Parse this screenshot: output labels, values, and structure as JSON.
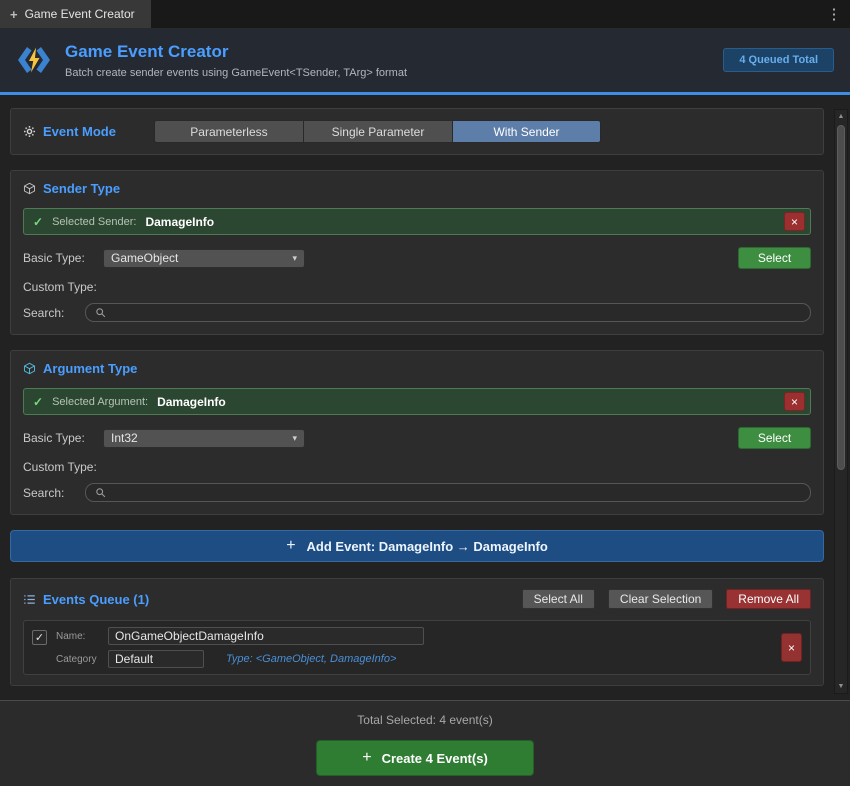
{
  "icons": {
    "plus": "+",
    "kebab": "⋮",
    "check": "✓",
    "close": "×",
    "chevron_down": "▾",
    "scroll_up": "▲",
    "scroll_down": "▼"
  },
  "tabbar": {
    "tab_title": "Game Event Creator"
  },
  "header": {
    "title": "Game Event Creator",
    "subtitle": "Batch create sender events using GameEvent<TSender, TArg> format",
    "badge": "4 Queued Total"
  },
  "event_mode": {
    "title": "Event Mode",
    "options": [
      "Parameterless",
      "Single Parameter",
      "With Sender"
    ],
    "selected": "With Sender"
  },
  "sender_type": {
    "title": "Sender Type",
    "selected_label": "Selected Sender:",
    "selected_value": "DamageInfo",
    "basic_type_label": "Basic Type:",
    "basic_type_value": "GameObject",
    "select_button": "Select",
    "custom_type_label": "Custom Type:",
    "search_label": "Search:",
    "search_value": ""
  },
  "argument_type": {
    "title": "Argument Type",
    "selected_label": "Selected Argument:",
    "selected_value": "DamageInfo",
    "basic_type_label": "Basic Type:",
    "basic_type_value": "Int32",
    "select_button": "Select",
    "custom_type_label": "Custom Type:",
    "search_label": "Search:",
    "search_value": ""
  },
  "add_event": {
    "label": "Add Event: DamageInfo → DamageInfo"
  },
  "events_queue": {
    "title": "Events Queue (1)",
    "select_all": "Select All",
    "clear_selection": "Clear Selection",
    "remove_all": "Remove All",
    "items": [
      {
        "checked": true,
        "name_label": "Name:",
        "name_value": "OnGameObjectDamageInfo",
        "category_label": "Category",
        "category_value": "Default",
        "type_info": "Type: <GameObject, DamageInfo>"
      }
    ]
  },
  "footer": {
    "total_selected": "Total Selected: 4 event(s)",
    "create_button": "Create 4 Event(s)"
  }
}
